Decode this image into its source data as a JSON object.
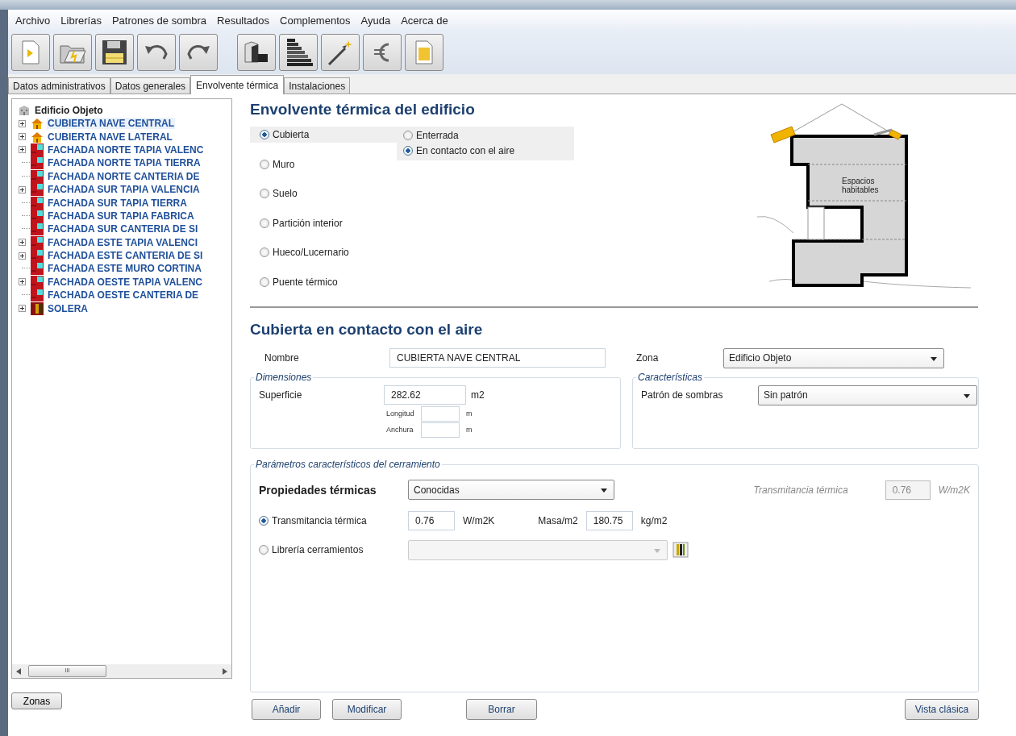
{
  "menu": [
    "Archivo",
    "Librerías",
    "Patrones de sombra",
    "Resultados",
    "Complementos",
    "Ayuda",
    "Acerca de"
  ],
  "toolbar": [
    {
      "kind": "new"
    },
    {
      "kind": "open"
    },
    {
      "kind": "save"
    },
    {
      "kind": "undo"
    },
    {
      "kind": "redo"
    },
    {
      "kind": "gap"
    },
    {
      "kind": "building"
    },
    {
      "kind": "rating"
    },
    {
      "kind": "wand"
    },
    {
      "kind": "euro"
    },
    {
      "kind": "document"
    }
  ],
  "tabs": [
    {
      "label": "Datos administrativos",
      "selected": false
    },
    {
      "label": "Datos generales",
      "selected": false
    },
    {
      "label": "Envolvente térmica",
      "selected": true
    },
    {
      "label": "Instalaciones",
      "selected": false
    }
  ],
  "tree": {
    "root": "Edificio Objeto",
    "children": [
      {
        "label": "CUBIERTA NAVE CENTRAL",
        "kind": "roof",
        "expandable": true,
        "selected": true
      },
      {
        "label": "CUBIERTA NAVE LATERAL",
        "kind": "roof",
        "expandable": true,
        "selected": false
      },
      {
        "label": "FACHADA NORTE TAPIA VALENC",
        "kind": "wall",
        "expandable": true,
        "selected": false
      },
      {
        "label": "FACHADA NORTE TAPIA TIERRA",
        "kind": "wall",
        "expandable": false,
        "selected": false
      },
      {
        "label": "FACHADA NORTE CANTERIA DE",
        "kind": "wall",
        "expandable": false,
        "selected": false
      },
      {
        "label": "FACHADA SUR TAPIA VALENCIA",
        "kind": "wall",
        "expandable": true,
        "selected": false
      },
      {
        "label": "FACHADA SUR TAPIA TIERRA",
        "kind": "wall",
        "expandable": false,
        "selected": false
      },
      {
        "label": "FACHADA SUR TAPIA FABRICA",
        "kind": "wall",
        "expandable": false,
        "selected": false
      },
      {
        "label": "FACHADA SUR CANTERIA DE SI",
        "kind": "wall",
        "expandable": false,
        "selected": false
      },
      {
        "label": "FACHADA ESTE TAPIA VALENCI",
        "kind": "wall",
        "expandable": true,
        "selected": false
      },
      {
        "label": "FACHADA ESTE CANTERIA DE SI",
        "kind": "wall",
        "expandable": true,
        "selected": false
      },
      {
        "label": "FACHADA ESTE MURO CORTINA",
        "kind": "wall",
        "expandable": false,
        "selected": false
      },
      {
        "label": "FACHADA OESTE TAPIA VALENC",
        "kind": "wall",
        "expandable": true,
        "selected": false
      },
      {
        "label": "FACHADA OESTE CANTERIA DE",
        "kind": "wall",
        "expandable": false,
        "selected": false
      },
      {
        "label": "SOLERA",
        "kind": "floor",
        "expandable": true,
        "selected": false
      }
    ]
  },
  "tree_scroll_mark": "III",
  "zones_button": "Zonas",
  "envelope": {
    "title": "Envolvente térmica del edificio",
    "types": [
      {
        "label": "Cubierta",
        "selected": true
      },
      {
        "label": "Muro",
        "selected": false
      },
      {
        "label": "Suelo",
        "selected": false
      },
      {
        "label": "Partición interior",
        "selected": false
      },
      {
        "label": "Hueco/Lucernario",
        "selected": false
      },
      {
        "label": "Puente térmico",
        "selected": false
      }
    ],
    "subtypes": [
      {
        "label": "Enterrada",
        "selected": false
      },
      {
        "label": "En contacto con el aire",
        "selected": true
      }
    ],
    "diagram_label": "Espacios habitables"
  },
  "element": {
    "title": "Cubierta en contacto con el aire",
    "name_label": "Nombre",
    "name_value": "CUBIERTA NAVE CENTRAL",
    "zone_label": "Zona",
    "zone_value": "Edificio Objeto",
    "dimensions": {
      "legend": "Dimensiones",
      "surface_label": "Superficie",
      "surface_value": "282.62",
      "surface_unit": "m2",
      "length_label": "Longitud",
      "length_unit": "m",
      "width_label": "Anchura",
      "width_unit": "m"
    },
    "features": {
      "legend": "Características",
      "shade_label": "Patrón de sombras",
      "shade_value": "Sin patrón"
    },
    "params": {
      "legend": "Parámetros característicos del cerramiento",
      "props_label": "Propiedades térmicas",
      "props_value": "Conocidas",
      "trans_label": "Transmitancia térmica",
      "trans_value": "0.76",
      "trans_unit": "W/m2K",
      "options": [
        {
          "label": "Transmitancia térmica",
          "selected": true
        },
        {
          "label": "Librería cerramientos",
          "selected": false
        }
      ],
      "u_value": "0.76",
      "u_unit": "W/m2K",
      "mass_label": "Masa/m2",
      "mass_value": "180.75",
      "mass_unit": "kg/m2"
    }
  },
  "buttons": [
    "Añadir",
    "Modificar",
    "Borrar",
    "Vista clásica"
  ]
}
